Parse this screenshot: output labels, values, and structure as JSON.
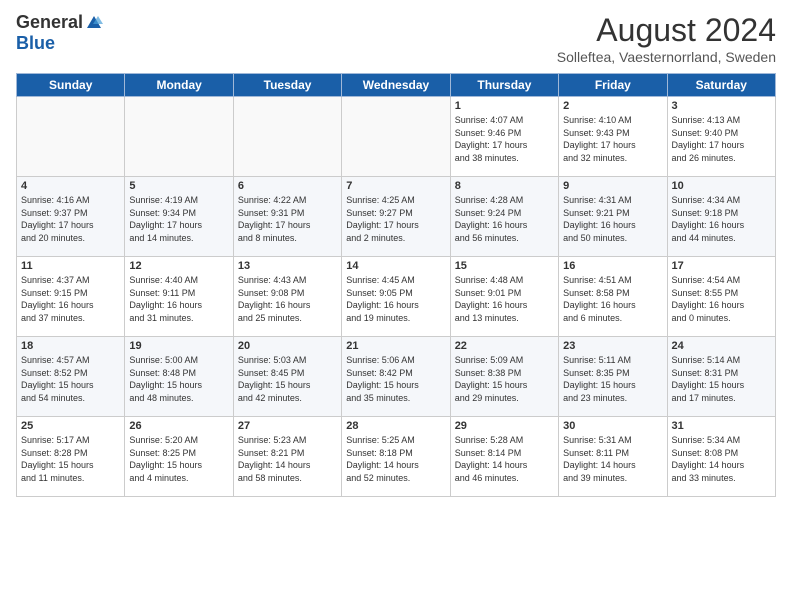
{
  "logo": {
    "general": "General",
    "blue": "Blue"
  },
  "header": {
    "title": "August 2024",
    "subtitle": "Solleftea, Vaesternorrland, Sweden"
  },
  "weekdays": [
    "Sunday",
    "Monday",
    "Tuesday",
    "Wednesday",
    "Thursday",
    "Friday",
    "Saturday"
  ],
  "weeks": [
    [
      {
        "day": "",
        "info": ""
      },
      {
        "day": "",
        "info": ""
      },
      {
        "day": "",
        "info": ""
      },
      {
        "day": "",
        "info": ""
      },
      {
        "day": "1",
        "info": "Sunrise: 4:07 AM\nSunset: 9:46 PM\nDaylight: 17 hours\nand 38 minutes."
      },
      {
        "day": "2",
        "info": "Sunrise: 4:10 AM\nSunset: 9:43 PM\nDaylight: 17 hours\nand 32 minutes."
      },
      {
        "day": "3",
        "info": "Sunrise: 4:13 AM\nSunset: 9:40 PM\nDaylight: 17 hours\nand 26 minutes."
      }
    ],
    [
      {
        "day": "4",
        "info": "Sunrise: 4:16 AM\nSunset: 9:37 PM\nDaylight: 17 hours\nand 20 minutes."
      },
      {
        "day": "5",
        "info": "Sunrise: 4:19 AM\nSunset: 9:34 PM\nDaylight: 17 hours\nand 14 minutes."
      },
      {
        "day": "6",
        "info": "Sunrise: 4:22 AM\nSunset: 9:31 PM\nDaylight: 17 hours\nand 8 minutes."
      },
      {
        "day": "7",
        "info": "Sunrise: 4:25 AM\nSunset: 9:27 PM\nDaylight: 17 hours\nand 2 minutes."
      },
      {
        "day": "8",
        "info": "Sunrise: 4:28 AM\nSunset: 9:24 PM\nDaylight: 16 hours\nand 56 minutes."
      },
      {
        "day": "9",
        "info": "Sunrise: 4:31 AM\nSunset: 9:21 PM\nDaylight: 16 hours\nand 50 minutes."
      },
      {
        "day": "10",
        "info": "Sunrise: 4:34 AM\nSunset: 9:18 PM\nDaylight: 16 hours\nand 44 minutes."
      }
    ],
    [
      {
        "day": "11",
        "info": "Sunrise: 4:37 AM\nSunset: 9:15 PM\nDaylight: 16 hours\nand 37 minutes."
      },
      {
        "day": "12",
        "info": "Sunrise: 4:40 AM\nSunset: 9:11 PM\nDaylight: 16 hours\nand 31 minutes."
      },
      {
        "day": "13",
        "info": "Sunrise: 4:43 AM\nSunset: 9:08 PM\nDaylight: 16 hours\nand 25 minutes."
      },
      {
        "day": "14",
        "info": "Sunrise: 4:45 AM\nSunset: 9:05 PM\nDaylight: 16 hours\nand 19 minutes."
      },
      {
        "day": "15",
        "info": "Sunrise: 4:48 AM\nSunset: 9:01 PM\nDaylight: 16 hours\nand 13 minutes."
      },
      {
        "day": "16",
        "info": "Sunrise: 4:51 AM\nSunset: 8:58 PM\nDaylight: 16 hours\nand 6 minutes."
      },
      {
        "day": "17",
        "info": "Sunrise: 4:54 AM\nSunset: 8:55 PM\nDaylight: 16 hours\nand 0 minutes."
      }
    ],
    [
      {
        "day": "18",
        "info": "Sunrise: 4:57 AM\nSunset: 8:52 PM\nDaylight: 15 hours\nand 54 minutes."
      },
      {
        "day": "19",
        "info": "Sunrise: 5:00 AM\nSunset: 8:48 PM\nDaylight: 15 hours\nand 48 minutes."
      },
      {
        "day": "20",
        "info": "Sunrise: 5:03 AM\nSunset: 8:45 PM\nDaylight: 15 hours\nand 42 minutes."
      },
      {
        "day": "21",
        "info": "Sunrise: 5:06 AM\nSunset: 8:42 PM\nDaylight: 15 hours\nand 35 minutes."
      },
      {
        "day": "22",
        "info": "Sunrise: 5:09 AM\nSunset: 8:38 PM\nDaylight: 15 hours\nand 29 minutes."
      },
      {
        "day": "23",
        "info": "Sunrise: 5:11 AM\nSunset: 8:35 PM\nDaylight: 15 hours\nand 23 minutes."
      },
      {
        "day": "24",
        "info": "Sunrise: 5:14 AM\nSunset: 8:31 PM\nDaylight: 15 hours\nand 17 minutes."
      }
    ],
    [
      {
        "day": "25",
        "info": "Sunrise: 5:17 AM\nSunset: 8:28 PM\nDaylight: 15 hours\nand 11 minutes."
      },
      {
        "day": "26",
        "info": "Sunrise: 5:20 AM\nSunset: 8:25 PM\nDaylight: 15 hours\nand 4 minutes."
      },
      {
        "day": "27",
        "info": "Sunrise: 5:23 AM\nSunset: 8:21 PM\nDaylight: 14 hours\nand 58 minutes."
      },
      {
        "day": "28",
        "info": "Sunrise: 5:25 AM\nSunset: 8:18 PM\nDaylight: 14 hours\nand 52 minutes."
      },
      {
        "day": "29",
        "info": "Sunrise: 5:28 AM\nSunset: 8:14 PM\nDaylight: 14 hours\nand 46 minutes."
      },
      {
        "day": "30",
        "info": "Sunrise: 5:31 AM\nSunset: 8:11 PM\nDaylight: 14 hours\nand 39 minutes."
      },
      {
        "day": "31",
        "info": "Sunrise: 5:34 AM\nSunset: 8:08 PM\nDaylight: 14 hours\nand 33 minutes."
      }
    ]
  ]
}
